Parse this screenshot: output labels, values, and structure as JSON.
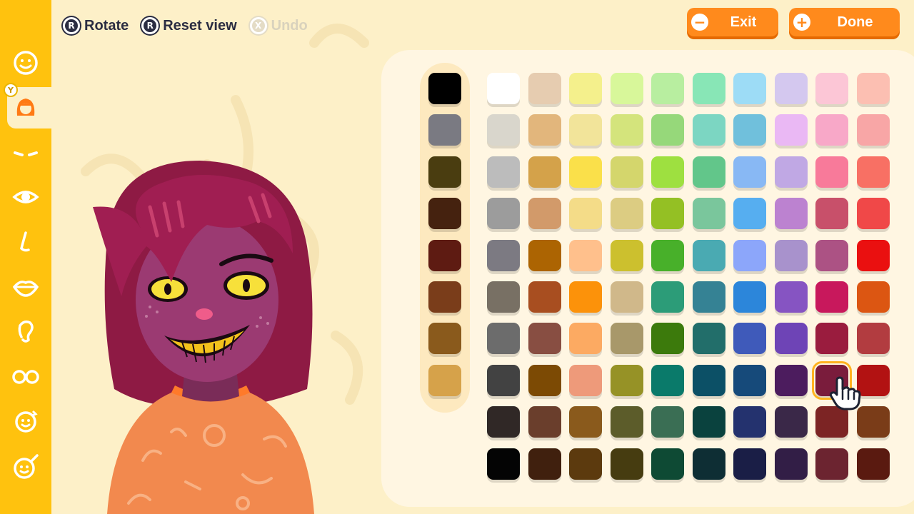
{
  "toolbar": {
    "rotate_label": "Rotate",
    "rotate_button": "R",
    "reset_label": "Reset view",
    "reset_button": "R",
    "undo_label": "Undo",
    "undo_button": "X",
    "exit_label": "Exit",
    "done_label": "Done"
  },
  "sidebar": {
    "active_badge": "Y",
    "items": [
      {
        "icon": "face-shape-icon"
      },
      {
        "icon": "hair-icon"
      },
      {
        "icon": "eyebrows-icon"
      },
      {
        "icon": "eye-icon"
      },
      {
        "icon": "nose-icon"
      },
      {
        "icon": "mouth-icon"
      },
      {
        "icon": "ear-icon"
      },
      {
        "icon": "glasses-icon"
      },
      {
        "icon": "face-rotate-icon"
      },
      {
        "icon": "makeup-icon"
      }
    ]
  },
  "palette": {
    "quick_colors": [
      "#000000",
      "#7a7a82",
      "#4a3d10",
      "#45220f",
      "#5e1b12",
      "#7a3d1a",
      "#8a5a1c",
      "#d6a24a"
    ],
    "grid": [
      [
        "#ffffff",
        "#e6ccb0",
        "#f4f08c",
        "#d8f79a",
        "#b8eea0",
        "#88e6b6",
        "#9ddcf6",
        "#d4c8ef",
        "#fcc6d6",
        "#fcbfb2"
      ],
      [
        "#d9d6cc",
        "#e2b67c",
        "#f2e49a",
        "#d4e47c",
        "#96d87a",
        "#7cd6c2",
        "#70c0dc",
        "#eab8f4",
        "#f8a8c8",
        "#f8a6a6"
      ],
      [
        "#bcbcbc",
        "#d4a24a",
        "#fae04a",
        "#d4d66c",
        "#9ee040",
        "#62c68a",
        "#88b8f4",
        "#c0a8e4",
        "#f87a9a",
        "#f87064"
      ],
      [
        "#9c9c9c",
        "#d29a6a",
        "#f4dc88",
        "#dccc82",
        "#94c024",
        "#7ac69c",
        "#56aef0",
        "#bc82d0",
        "#c8506a",
        "#f04848"
      ],
      [
        "#7c7a82",
        "#ac6402",
        "#ffc08c",
        "#ccc02e",
        "#48b02a",
        "#4aaab2",
        "#8ca6fa",
        "#a892cc",
        "#ac5284",
        "#ea1010"
      ],
      [
        "#787064",
        "#a84e20",
        "#fc920a",
        "#d0b88a",
        "#2c9c78",
        "#358294",
        "#2c86da",
        "#8654c2",
        "#c8185c",
        "#dc5612"
      ],
      [
        "#6c6c6c",
        "#884e42",
        "#fcaa62",
        "#a8986a",
        "#3c7a0c",
        "#226e6a",
        "#3f5aba",
        "#6e44b6",
        "#9a1c3e",
        "#b23c40"
      ],
      [
        "#424242",
        "#7c4a04",
        "#ee9a7a",
        "#969226",
        "#0a7a6a",
        "#0c5066",
        "#164a7a",
        "#4c1c5e",
        "#7a1c3c",
        "#b21212"
      ],
      [
        "#302826",
        "#6a3e2c",
        "#8a5a1c",
        "#5c5c2a",
        "#3a6e54",
        "#0a423e",
        "#24326e",
        "#3a2848",
        "#7c2424",
        "#7a3c18"
      ],
      [
        "#040404",
        "#40200e",
        "#5c3a0e",
        "#463c10",
        "#0e4a34",
        "#0e2e34",
        "#1a1e46",
        "#321e46",
        "#6c2430",
        "#5a1a10"
      ]
    ],
    "selected": {
      "row": 7,
      "col": 8
    }
  }
}
